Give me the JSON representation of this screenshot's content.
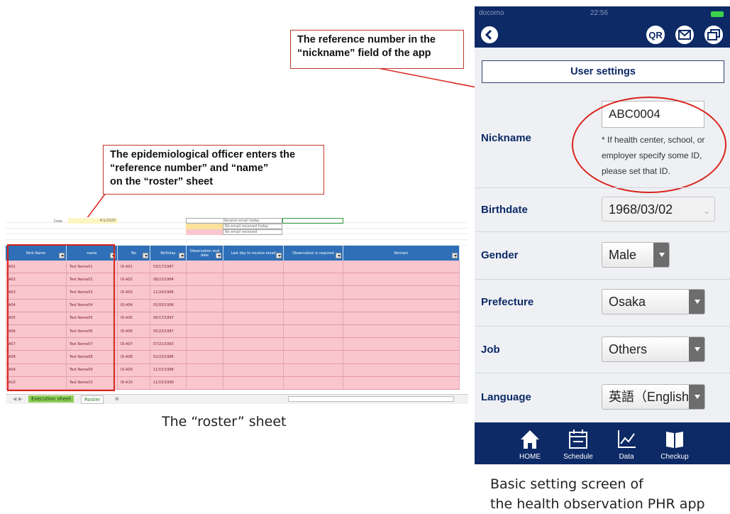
{
  "callouts": {
    "top_right": [
      "The reference number in the",
      "“nickname” field of the app"
    ],
    "middle_left": [
      "The epidemiological officer enters the",
      "“reference number” and “name”",
      "on the “roster” sheet"
    ]
  },
  "captions": {
    "roster": "The “roster” sheet",
    "app_line1": "Basic setting screen of",
    "app_line2": "the health observation PHR app"
  },
  "sheet": {
    "date_label": "Date",
    "date_value": "4/1/2020",
    "legend": [
      "Receive email today",
      "No email received today",
      "No email received"
    ],
    "headers": [
      "Nick Name",
      "name",
      "No",
      "Birthday",
      "Observation end date",
      "Last day to receive email",
      "Observation is required",
      "Remark"
    ],
    "rows": [
      [
        "A01",
        "Test Name01",
        "ID-A01",
        "03/17/1987"
      ],
      [
        "A02",
        "Test Name02",
        "ID-A02",
        "08/22/1984"
      ],
      [
        "A03",
        "Test Name03",
        "ID-A03",
        "11/24/1986"
      ],
      [
        "A04",
        "Test Name04",
        "ID-A04",
        "01/05/1996"
      ],
      [
        "A05",
        "Test Name05",
        "ID-A05",
        "06/17/1997"
      ],
      [
        "A06",
        "Test Name06",
        "ID-A06",
        "05/23/1987"
      ],
      [
        "A07",
        "Test Name07",
        "ID-A07",
        "07/21/1993"
      ],
      [
        "A08",
        "Test Name08",
        "ID-A08",
        "02/23/1986"
      ],
      [
        "A09",
        "Test Name09",
        "ID-A09",
        "11/15/1988"
      ],
      [
        "A10",
        "Test Name10",
        "ID-A10",
        "11/15/1990"
      ]
    ],
    "tabs": [
      "Execution sheet",
      "Roster"
    ]
  },
  "phone": {
    "status": {
      "carrier": "docomo",
      "time": "22:56"
    },
    "nav": {
      "back": "back-icon",
      "qr": "QR",
      "mail": "mail-icon",
      "windows": "windows-icon"
    },
    "page_title": "User settings",
    "fields": {
      "nickname": {
        "label": "Nickname",
        "value": "ABC0004",
        "note": [
          "* If health center, school, or",
          "employer specify some ID,",
          "please set that ID."
        ]
      },
      "birthdate": {
        "label": "Birthdate",
        "value": "1968/03/02"
      },
      "gender": {
        "label": "Gender",
        "value": "Male"
      },
      "prefecture": {
        "label": "Prefecture",
        "value": "Osaka"
      },
      "job": {
        "label": "Job",
        "value": "Others"
      },
      "language": {
        "label": "Language",
        "value": "英語（English）"
      }
    },
    "tabbar": [
      {
        "label": "HOME",
        "icon": "home-icon"
      },
      {
        "label": "Schedule",
        "icon": "calendar-icon"
      },
      {
        "label": "Data",
        "icon": "chart-icon"
      },
      {
        "label": "Checkup",
        "icon": "book-icon"
      }
    ]
  },
  "colors": {
    "navy": "#0d2a66",
    "header_blue": "#2e6fb7",
    "row_pink": "#f9c6cd",
    "annotation_red": "#d9251c"
  }
}
